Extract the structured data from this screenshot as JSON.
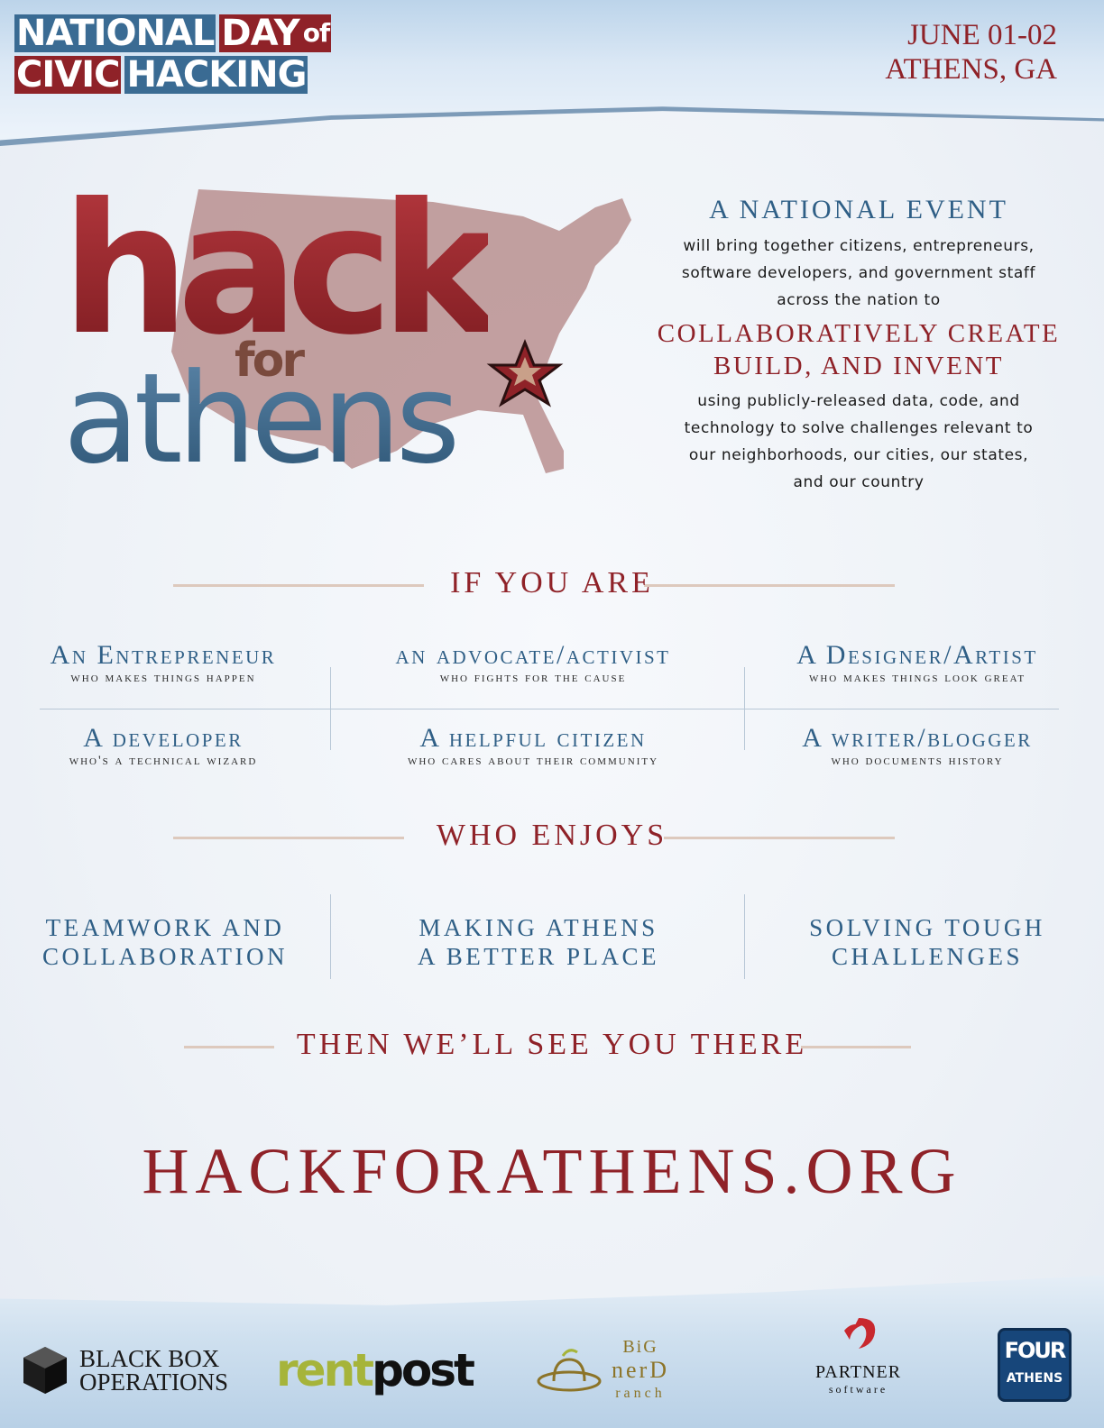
{
  "header": {
    "title_line1": "NATIONAL DAY OF",
    "title_line1_words": [
      "NATIONAL",
      "DAY",
      "of"
    ],
    "title_line2_words": [
      "CIVIC",
      "HACKING"
    ],
    "date": "JUNE 01-02",
    "location": "ATHENS, GA"
  },
  "logo": {
    "word_hack": "hack",
    "word_for": "for",
    "word_athens": "athens"
  },
  "event": {
    "heading": "A NATIONAL EVENT",
    "lines1": [
      "will bring together citizens, entrepreneurs,",
      "software developers, and government staff",
      "across the nation to"
    ],
    "big_lines": [
      "COLLABORATIVELY CREATE",
      "BUILD, AND INVENT"
    ],
    "lines2": [
      "using publicly-released data, code, and",
      "technology to solve challenges relevant to",
      "our neighborhoods, our cities, our states,",
      "and our country"
    ]
  },
  "sections": {
    "if_you_are": "IF YOU ARE",
    "who_enjoys": "WHO ENJOYS",
    "see_you": "THEN WE’LL SEE YOU THERE"
  },
  "roles": [
    {
      "role": "An Entrepreneur",
      "desc": "who makes things happen"
    },
    {
      "role": "an advocate/activist",
      "desc": "who fights for the cause"
    },
    {
      "role": "A Designer/Artist",
      "desc": "who makes things look great"
    },
    {
      "role": "A developer",
      "desc": "who's a technical wizard"
    },
    {
      "role": "A helpful citizen",
      "desc": "who cares about their community"
    },
    {
      "role": "A writer/blogger",
      "desc": "who documents history"
    }
  ],
  "enjoys": [
    {
      "line1": "TEAMWORK AND",
      "line2": "COLLABORATION"
    },
    {
      "line1": "MAKING ATHENS",
      "line2": "A BETTER PLACE"
    },
    {
      "line1": "SOLVING TOUGH",
      "line2": "CHALLENGES"
    }
  ],
  "url": "HACKFORATHENS.ORG",
  "sponsors": {
    "bbo_line1": "BLACK BOX",
    "bbo_line2": "OPERATIONS",
    "rentpost_a": "rent",
    "rentpost_b": "post",
    "bnr_line1": "BiG",
    "bnr_line2": "nerD",
    "bnr_line3": "ranch",
    "partner_line1": "PARTNER",
    "partner_line2": "software",
    "four_top": "FOUR",
    "four_bottom": "ATHENS"
  },
  "colors": {
    "brand_red": "#8f2228",
    "brand_blue": "#2f5f86"
  }
}
